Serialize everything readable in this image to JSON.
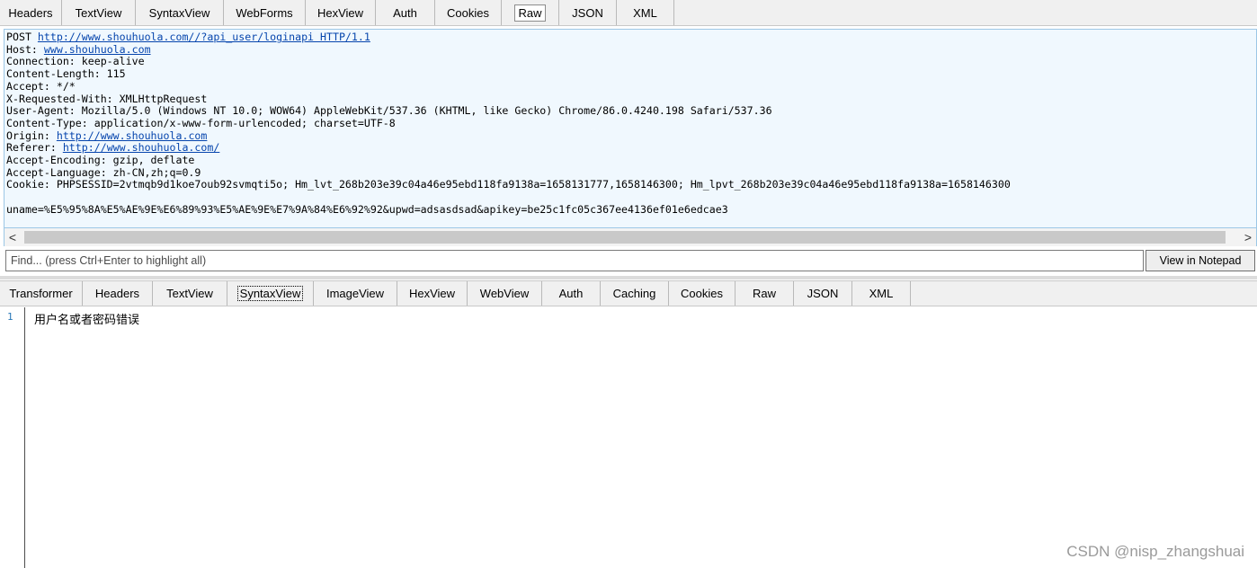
{
  "request_tabs": [
    "Headers",
    "TextView",
    "SyntaxView",
    "WebForms",
    "HexView",
    "Auth",
    "Cookies",
    "Raw",
    "JSON",
    "XML"
  ],
  "request_active_tab": "Raw",
  "request": {
    "method": "POST",
    "url": "http://www.shouhuola.com//?api_user/loginapi HTTP/1.1",
    "host_label": "Host:",
    "host": "www.shouhuola.com",
    "connection": "Connection: keep-alive",
    "content_length": "Content-Length: 115",
    "accept": "Accept: */*",
    "x_requested_with": "X-Requested-With: XMLHttpRequest",
    "user_agent": "User-Agent: Mozilla/5.0 (Windows NT 10.0; WOW64) AppleWebKit/537.36 (KHTML, like Gecko) Chrome/86.0.4240.198 Safari/537.36",
    "content_type": "Content-Type: application/x-www-form-urlencoded; charset=UTF-8",
    "origin_label": "Origin:",
    "origin": "http://www.shouhuola.com",
    "referer_label": "Referer:",
    "referer": "http://www.shouhuola.com/",
    "accept_encoding": "Accept-Encoding: gzip, deflate",
    "accept_language": "Accept-Language: zh-CN,zh;q=0.9",
    "cookie": "Cookie: PHPSESSID=2vtmqb9d1koe7oub92svmqti5o; Hm_lvt_268b203e39c04a46e95ebd118fa9138a=1658131777,1658146300; Hm_lpvt_268b203e39c04a46e95ebd118fa9138a=1658146300",
    "body": "uname=%E5%95%8A%E5%AE%9E%E6%89%93%E5%AE%9E%E7%9A%84%E6%92%92&upwd=adsasdsad&apikey=be25c1fc05c367ee4136ef01e6edcae3"
  },
  "find": {
    "placeholder": "Find... (press Ctrl+Enter to highlight all)",
    "notepad_button": "View in Notepad"
  },
  "response_tabs": [
    "Transformer",
    "Headers",
    "TextView",
    "SyntaxView",
    "ImageView",
    "HexView",
    "WebView",
    "Auth",
    "Caching",
    "Cookies",
    "Raw",
    "JSON",
    "XML"
  ],
  "response_active_tab": "SyntaxView",
  "response": {
    "line_number": "1",
    "text": "用户名或者密码错误"
  },
  "scroll": {
    "left_arrow": "<",
    "right_arrow": ">"
  },
  "watermark": "CSDN @nisp_zhangshuai"
}
